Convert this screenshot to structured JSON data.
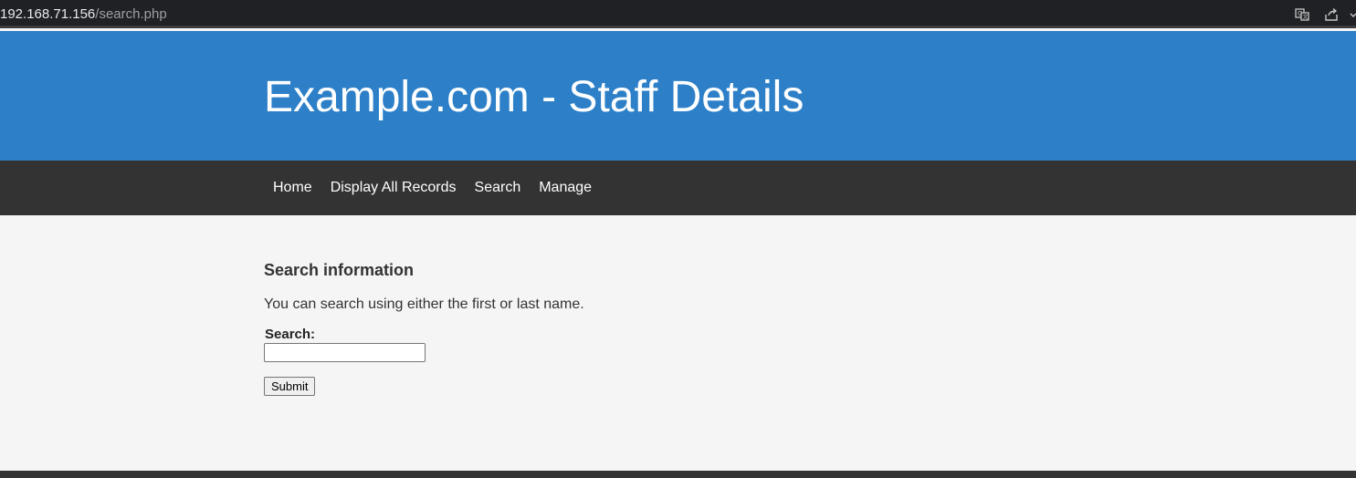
{
  "browser": {
    "url_host": "192.168.71.156",
    "url_path": "/search.php",
    "icons": [
      "translate-icon",
      "share-icon",
      "chevron-down-icon"
    ]
  },
  "header": {
    "title": "Example.com - Staff Details",
    "background_color": "#2d80c8"
  },
  "nav": {
    "background_color": "#333333",
    "items": [
      {
        "label": "Home"
      },
      {
        "label": "Display All Records"
      },
      {
        "label": "Search"
      },
      {
        "label": "Manage"
      }
    ]
  },
  "main": {
    "heading": "Search information",
    "description": "You can search using either the first or last name.",
    "search_label": "Search:",
    "search_value": "",
    "submit_label": "Submit"
  }
}
